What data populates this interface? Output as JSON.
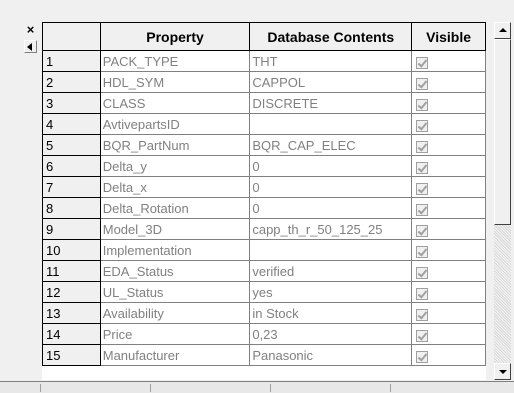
{
  "toolbar": {
    "close_glyph": "×"
  },
  "grid": {
    "headers": [
      "",
      "Property",
      "Database Contents",
      "Visible"
    ],
    "rows": [
      {
        "num": "1",
        "property": "PACK_TYPE",
        "contents": "THT",
        "visible": true
      },
      {
        "num": "2",
        "property": "HDL_SYM",
        "contents": "CAPPOL",
        "visible": true
      },
      {
        "num": "3",
        "property": "CLASS",
        "contents": "DISCRETE",
        "visible": true
      },
      {
        "num": "4",
        "property": "AvtivepartsID",
        "contents": "",
        "visible": true
      },
      {
        "num": "5",
        "property": "BQR_PartNum",
        "contents": "BQR_CAP_ELEC",
        "visible": true
      },
      {
        "num": "6",
        "property": "Delta_y",
        "contents": "0",
        "visible": true
      },
      {
        "num": "7",
        "property": "Delta_x",
        "contents": "0",
        "visible": true
      },
      {
        "num": "8",
        "property": "Delta_Rotation",
        "contents": "0",
        "visible": true
      },
      {
        "num": "9",
        "property": "Model_3D",
        "contents": "capp_th_r_50_125_25",
        "visible": true
      },
      {
        "num": "10",
        "property": "Implementation",
        "contents": "",
        "visible": true
      },
      {
        "num": "11",
        "property": "EDA_Status",
        "contents": "verified",
        "visible": true
      },
      {
        "num": "12",
        "property": "UL_Status",
        "contents": "yes",
        "visible": true
      },
      {
        "num": "13",
        "property": "Availability",
        "contents": "in Stock",
        "visible": true
      },
      {
        "num": "14",
        "property": "Price",
        "contents": "0,23",
        "visible": true
      },
      {
        "num": "15",
        "property": "Manufacturer",
        "contents": "Panasonic",
        "visible": true
      }
    ]
  },
  "icons": {
    "close": "close-icon",
    "pin": "pin-icon",
    "scroll_up": "arrow-up-icon",
    "scroll_down": "arrow-down-icon",
    "checkbox": "checkbox-icon"
  }
}
